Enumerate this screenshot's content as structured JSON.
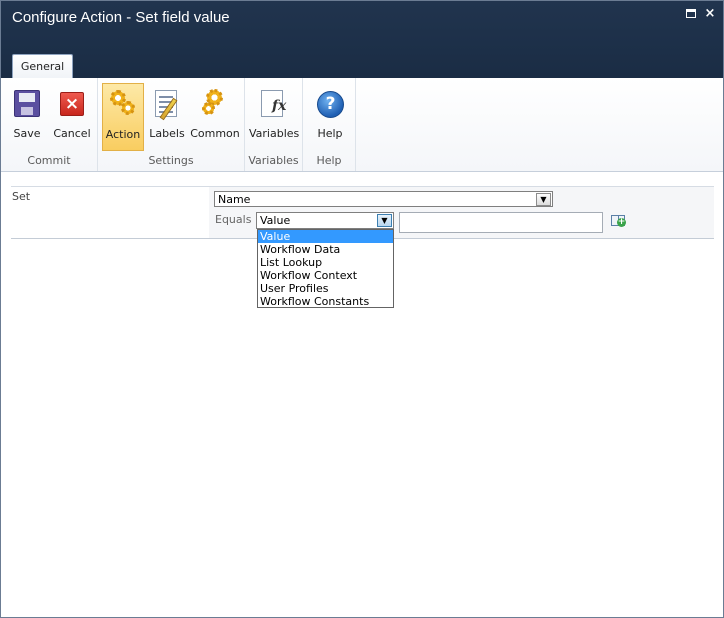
{
  "window": {
    "title": "Configure Action - Set field value",
    "close_glyph": "×"
  },
  "ribbon": {
    "tab": "General",
    "groups": {
      "commit": {
        "label": "Commit",
        "save": "Save",
        "cancel": "Cancel"
      },
      "settings": {
        "label": "Settings",
        "action": "Action",
        "labels": "Labels",
        "common": "Common"
      },
      "variables": {
        "label": "Variables",
        "variables": "Variables"
      },
      "help": {
        "label": "Help",
        "help": "Help"
      }
    },
    "icons": [
      "save-icon",
      "cancel-icon",
      "action-gears-icon",
      "labels-icon",
      "common-gears-icon",
      "variables-fx-icon",
      "help-icon"
    ],
    "active_button": "Action"
  },
  "form": {
    "set_label": "Set",
    "set_value": "Name",
    "equals_label": "Equals",
    "equals_value": "Value",
    "value_input": "",
    "dropdown_options": [
      "Value",
      "Workflow Data",
      "List Lookup",
      "Workflow Context",
      "User Profiles",
      "Workflow Constants"
    ],
    "dropdown_selected": "Value"
  },
  "colors": {
    "header": "#1d3049",
    "active_button": "#f9cd60",
    "selection": "#3399ff"
  }
}
